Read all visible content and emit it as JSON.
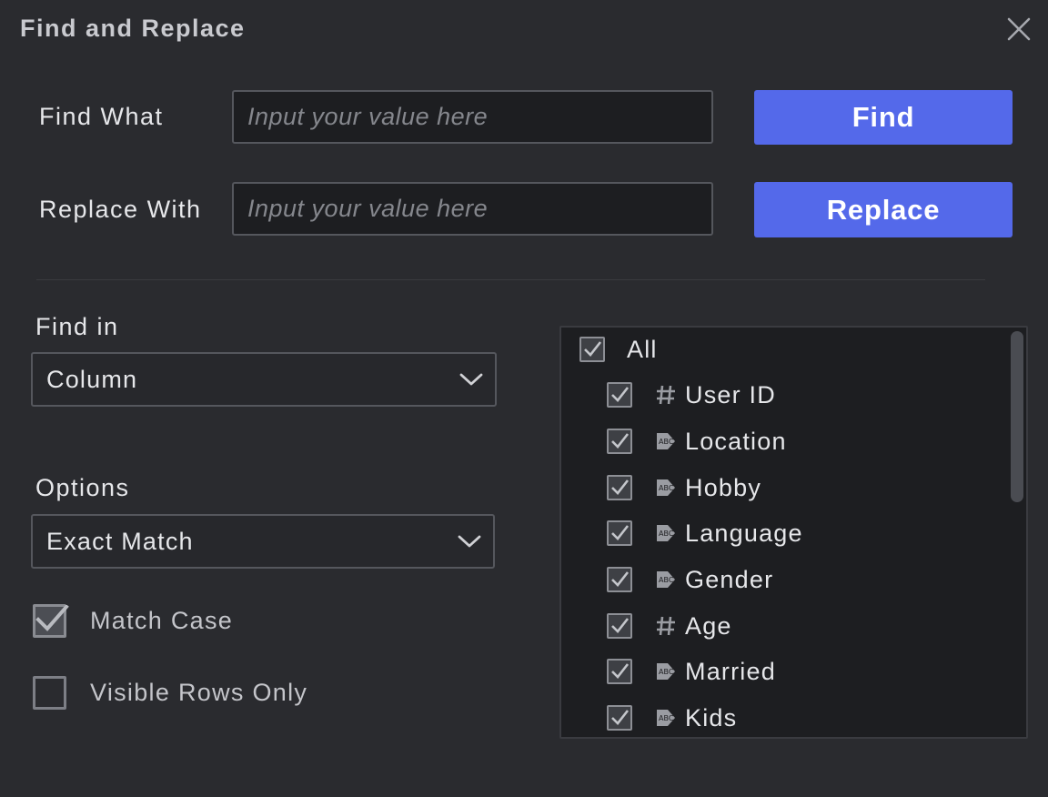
{
  "dialog": {
    "title": "Find and Replace"
  },
  "find": {
    "label": "Find What",
    "value": "",
    "placeholder": "Input your value here",
    "button_label": "Find"
  },
  "replace": {
    "label": "Replace With",
    "value": "",
    "placeholder": "Input your value here",
    "button_label": "Replace"
  },
  "find_in": {
    "label": "Find in",
    "selected": "Column"
  },
  "options": {
    "label": "Options",
    "selected": "Exact Match",
    "match_case": {
      "label": "Match Case",
      "checked": true
    },
    "visible_rows_only": {
      "label": "Visible Rows Only",
      "checked": false
    }
  },
  "columns": {
    "all": {
      "label": "All",
      "checked": true
    },
    "items": [
      {
        "label": "User ID",
        "type": "number",
        "icon": "hash-icon",
        "checked": true
      },
      {
        "label": "Location",
        "type": "text",
        "icon": "text-tag-icon",
        "checked": true
      },
      {
        "label": "Hobby",
        "type": "text",
        "icon": "text-tag-icon",
        "checked": true
      },
      {
        "label": "Language",
        "type": "text",
        "icon": "text-tag-icon",
        "checked": true
      },
      {
        "label": "Gender",
        "type": "text",
        "icon": "text-tag-icon",
        "checked": true
      },
      {
        "label": "Age",
        "type": "number",
        "icon": "hash-icon",
        "checked": true
      },
      {
        "label": "Married",
        "type": "text",
        "icon": "text-tag-icon",
        "checked": true
      },
      {
        "label": "Kids",
        "type": "text",
        "icon": "text-tag-icon",
        "checked": true
      }
    ]
  },
  "colors": {
    "background": "#2a2b2f",
    "input_background": "#1d1e21",
    "accent": "#5469ea",
    "text": "#e6e7ea"
  }
}
